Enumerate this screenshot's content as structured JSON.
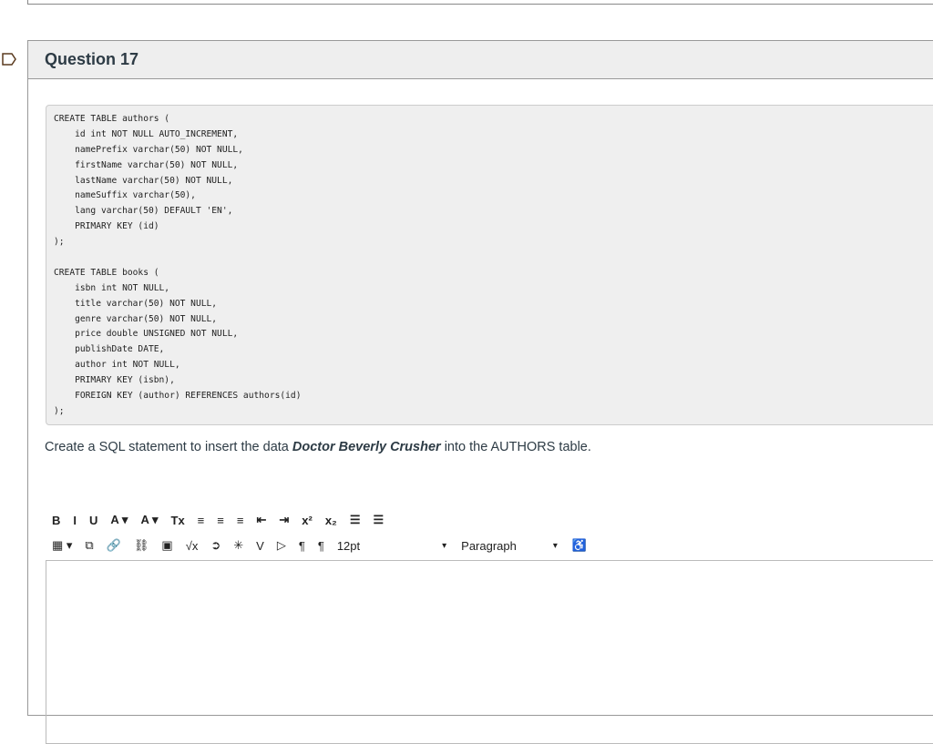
{
  "question": {
    "title": "Question 17"
  },
  "code_lines": [
    "CREATE TABLE authors (",
    "    id int NOT NULL AUTO_INCREMENT,",
    "    namePrefix varchar(50) NOT NULL,",
    "    firstName varchar(50) NOT NULL,",
    "    lastName varchar(50) NOT NULL,",
    "    nameSuffix varchar(50),",
    "    lang varchar(50) DEFAULT 'EN',",
    "    PRIMARY KEY (id)",
    ");",
    "",
    "CREATE TABLE books (",
    "    isbn int NOT NULL,",
    "    title varchar(50) NOT NULL,",
    "    genre varchar(50) NOT NULL,",
    "    price double UNSIGNED NOT NULL,",
    "    publishDate DATE,",
    "    author int NOT NULL,",
    "    PRIMARY KEY (isbn),",
    "    FOREIGN KEY (author) REFERENCES authors(id)",
    ");"
  ],
  "prompt": {
    "before": "Create a SQL statement to insert the data ",
    "emphasis": "Doctor Beverly Crusher",
    "after": " into the AUTHORS table."
  },
  "toolbar": {
    "row1": [
      "B",
      "I",
      "U",
      "A ▾",
      "A ▾",
      "Tx",
      "≡",
      "≡",
      "≡",
      "⇤",
      "⇥",
      "x²",
      "x₂",
      "☰",
      "☰"
    ],
    "row1_names": [
      "bold",
      "italic",
      "underline",
      "text-color",
      "background-color",
      "clear-format",
      "align-left",
      "align-center",
      "align-right",
      "outdent",
      "indent",
      "superscript",
      "subscript",
      "bullet-list",
      "numbered-list"
    ],
    "row2": [
      "▦ ▾",
      "⧉",
      "🔗",
      "⛓",
      "▣",
      "√x",
      "➲",
      "✳",
      "V",
      "▷",
      "¶",
      "¶"
    ],
    "row2_names": [
      "table",
      "media",
      "link",
      "unlink",
      "image",
      "equation",
      "embed",
      "apps",
      "v-icon",
      "video",
      "ltr",
      "rtl"
    ],
    "font_size": "12pt",
    "block_format": "Paragraph",
    "accessibility": "♿"
  }
}
